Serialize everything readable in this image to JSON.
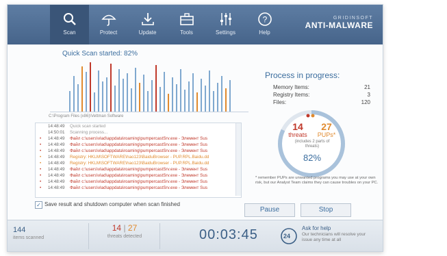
{
  "nav": [
    {
      "label": "Scan",
      "icon": "search-icon"
    },
    {
      "label": "Protect",
      "icon": "umbrella-icon"
    },
    {
      "label": "Update",
      "icon": "download-icon"
    },
    {
      "label": "Tools",
      "icon": "toolbox-icon"
    },
    {
      "label": "Settings",
      "icon": "sliders-icon"
    },
    {
      "label": "Help",
      "icon": "question-icon"
    }
  ],
  "brand": {
    "top": "GRIDINSOFT",
    "bottom": "ANTI-MALWARE"
  },
  "scan": {
    "status": "Quick Scan started:",
    "percent": "82%",
    "path": "C:\\Program Files (x86)\\Vettman Software"
  },
  "colors": {
    "accent": "#3b6d9e",
    "threat": "#c0392b",
    "pup": "#e08a2e",
    "bar": "#7fa8cf"
  },
  "log": [
    {
      "time": "14:48:49",
      "msg": "Quick scan started",
      "kind": "info"
    },
    {
      "time": "14:50:01",
      "msg": "Scanning process...",
      "kind": "info"
    },
    {
      "time": "14:48:49",
      "msg": "Файл c:\\users\\vlad\\appdata\\roaming\\pumpercastSrv.exe - Элемент Sus",
      "kind": "threat"
    },
    {
      "time": "14:48:49",
      "msg": "Файл c:\\users\\vlad\\appdata\\roaming\\pumpercastSrv.exe - Элемент Sus",
      "kind": "threat"
    },
    {
      "time": "14:48:49",
      "msg": "Файл c:\\users\\vlad\\appdata\\roaming\\pumpercastSrv.exe - Элемент Sus",
      "kind": "threat"
    },
    {
      "time": "14:48:49",
      "msg": "Registry: HKLM\\SOFTWARE\\hao123\\BaiduBrowser - PUP.RPL.Baidu.dd",
      "kind": "pup"
    },
    {
      "time": "14:48:49",
      "msg": "Registry: HKLM\\SOFTWARE\\hao123\\BaiduBrowser - PUP.RPL.Baidu.dd",
      "kind": "pup"
    },
    {
      "time": "14:48:49",
      "msg": "Файл c:\\users\\vlad\\appdata\\roaming\\pumpercastSrv.exe - Элемент Sus",
      "kind": "threat"
    },
    {
      "time": "14:48:49",
      "msg": "Файл c:\\users\\vlad\\appdata\\roaming\\pumpercastSrv.exe - Элемент Sus",
      "kind": "threat"
    },
    {
      "time": "14:48:49",
      "msg": "Файл c:\\users\\vlad\\appdata\\roaming\\pumpercastSrv.exe - Элемент Sus",
      "kind": "threat"
    },
    {
      "time": "14:48:49",
      "msg": "Файл c:\\users\\vlad\\appdata\\roaming\\pumpercastSrv.exe - Элемент Sus",
      "kind": "threat"
    }
  ],
  "save_option": "Save result and shutdown computer when scan finished",
  "process": {
    "title": "Process in progress:",
    "memory_label": "Memory Items:",
    "memory_value": "21",
    "registry_label": "Registry Items:",
    "registry_value": "3",
    "files_label": "Files:",
    "files_value": "120"
  },
  "summary": {
    "threats": "14",
    "threats_label": "threats",
    "pups": "27",
    "pups_label": "PUPs*",
    "pups_note": "(includes 2 parts of threats)",
    "percent": "82%"
  },
  "pup_note": "* remember PUPs are unwanted programs you may use at your own risk, but our Analyst Team claims they can cause troubles on your PC.",
  "buttons": {
    "pause": "Pause",
    "stop": "Stop"
  },
  "status": {
    "items_scanned": "144",
    "items_scanned_label": "items scanned",
    "threats": "14",
    "pups": "27",
    "threats_detected_label": "threats detected",
    "timer": "00:03:45",
    "help_badge": "24",
    "help_title": "Ask for help",
    "help_text": "Our technicians will resolve your issue any time at all"
  }
}
